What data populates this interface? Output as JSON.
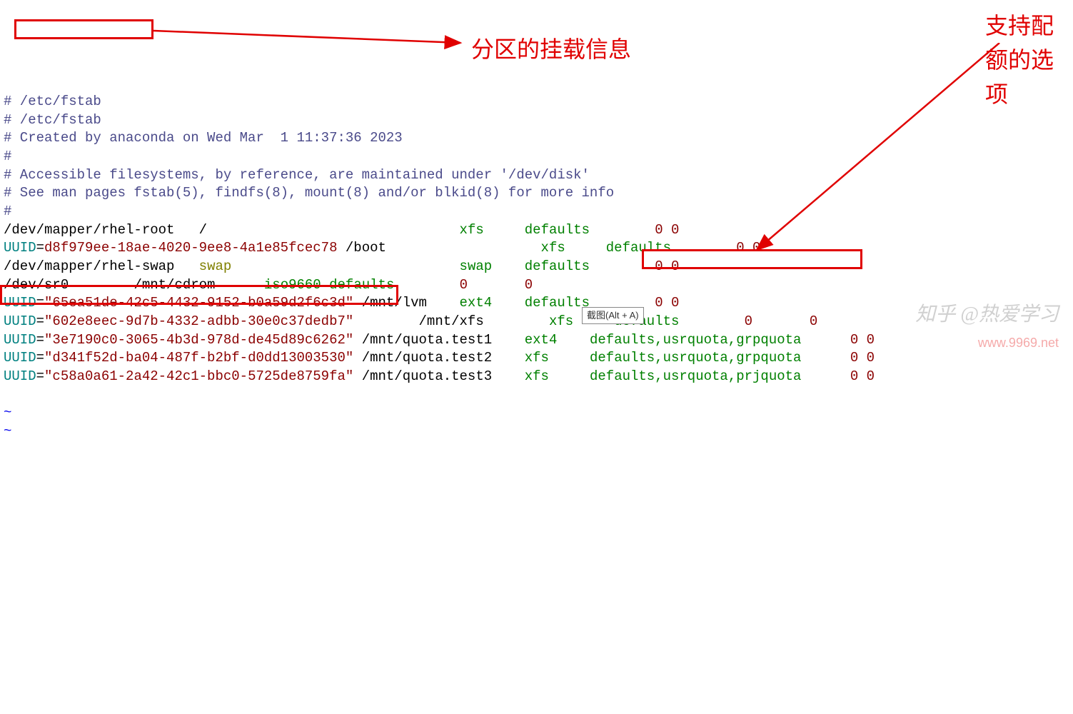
{
  "comments": {
    "l1": "# /etc/fstab",
    "l2": "# /etc/fstab",
    "l3": "# Created by anaconda on Wed Mar  1 11:37:36 2023",
    "l4": "#",
    "l5": "# Accessible filesystems, by reference, are maintained under '/dev/disk'",
    "l6": "# See man pages fstab(5), findfs(8), mount(8) and/or blkid(8) for more info",
    "l7": "#"
  },
  "entries": {
    "e1": {
      "dev": "/dev/mapper/rhel-root",
      "mount": "/",
      "fs": "xfs",
      "opts": "defaults",
      "d1": "0",
      "d2": "0"
    },
    "e2": {
      "key": "UUID",
      "eq": "=",
      "uuid": "d8f979ee-18ae-4020-9ee8-4a1e85fcec78",
      "mount": "/boot",
      "fs": "xfs",
      "opts": "defaults",
      "d1": "0",
      "d2": "0"
    },
    "e3": {
      "dev": "/dev/mapper/rhel-swap",
      "mount": "swap",
      "fs": "swap",
      "opts": "defaults",
      "d1": "0",
      "d2": "0"
    },
    "e4": {
      "dev": "/dev/sr0",
      "mount": "/mnt/cdrom",
      "fs": "iso9660",
      "opts": "defaults",
      "d1": "0",
      "d2": "0"
    },
    "e5": {
      "key": "UUID",
      "eq": "=",
      "q1": "\"",
      "uuid": "65ea51de-42c5-4432-9152-b0a59d2f6c3d",
      "q2": "\"",
      "mount": "/mnt/lvm",
      "fs": "ext4",
      "opts": "defaults",
      "d1": "0",
      "d2": "0"
    },
    "e6": {
      "key": "UUID",
      "eq": "=",
      "q1": "\"",
      "uuid": "602e8eec-9d7b-4332-adbb-30e0c37dedb7",
      "q2": "\"",
      "mount": "/mnt/xfs",
      "fs": "xfs",
      "opts": "defaults",
      "d1": "0",
      "d2": "0"
    },
    "e7": {
      "key": "UUID",
      "eq": "=",
      "q1": "\"",
      "uuid": "3e7190c0-3065-4b3d-978d-de45d89c6262",
      "q2": "\"",
      "mount": "/mnt/quota.test1",
      "fs": "ext4",
      "opts": "defaults,usrquota,grpquota",
      "d1": "0",
      "d2": "0"
    },
    "e8": {
      "key": "UUID",
      "eq": "=",
      "q1": "\"",
      "uuid": "d341f52d-ba04-487f-b2bf-d0dd13003530",
      "q2": "\"",
      "mount": "/mnt/quota.test2",
      "fs": "xfs",
      "opts": "defaults,usrquota,grpquota",
      "d1": "0",
      "d2": "0"
    },
    "e9": {
      "key": "UUID",
      "eq": "=",
      "q1": "\"",
      "uuid": "c58a0a61-2a42-42c1-bbc0-5725de8759fa",
      "q2": "\"",
      "mount": "/mnt/quota.test3",
      "fs": "xfs",
      "opts": "defaults,usrquota,prjquota",
      "d1": "0",
      "d2": "0"
    }
  },
  "tilde1": "~",
  "tilde2": "~",
  "annotations": {
    "a1": "分区的挂载信息",
    "a2_l1": "支持配",
    "a2_l2": "额的选",
    "a2_l3": "项"
  },
  "tooltip": "截图(Alt + A)",
  "watermark1": "知乎 @热爱学习",
  "watermark2": "www.9969.net"
}
